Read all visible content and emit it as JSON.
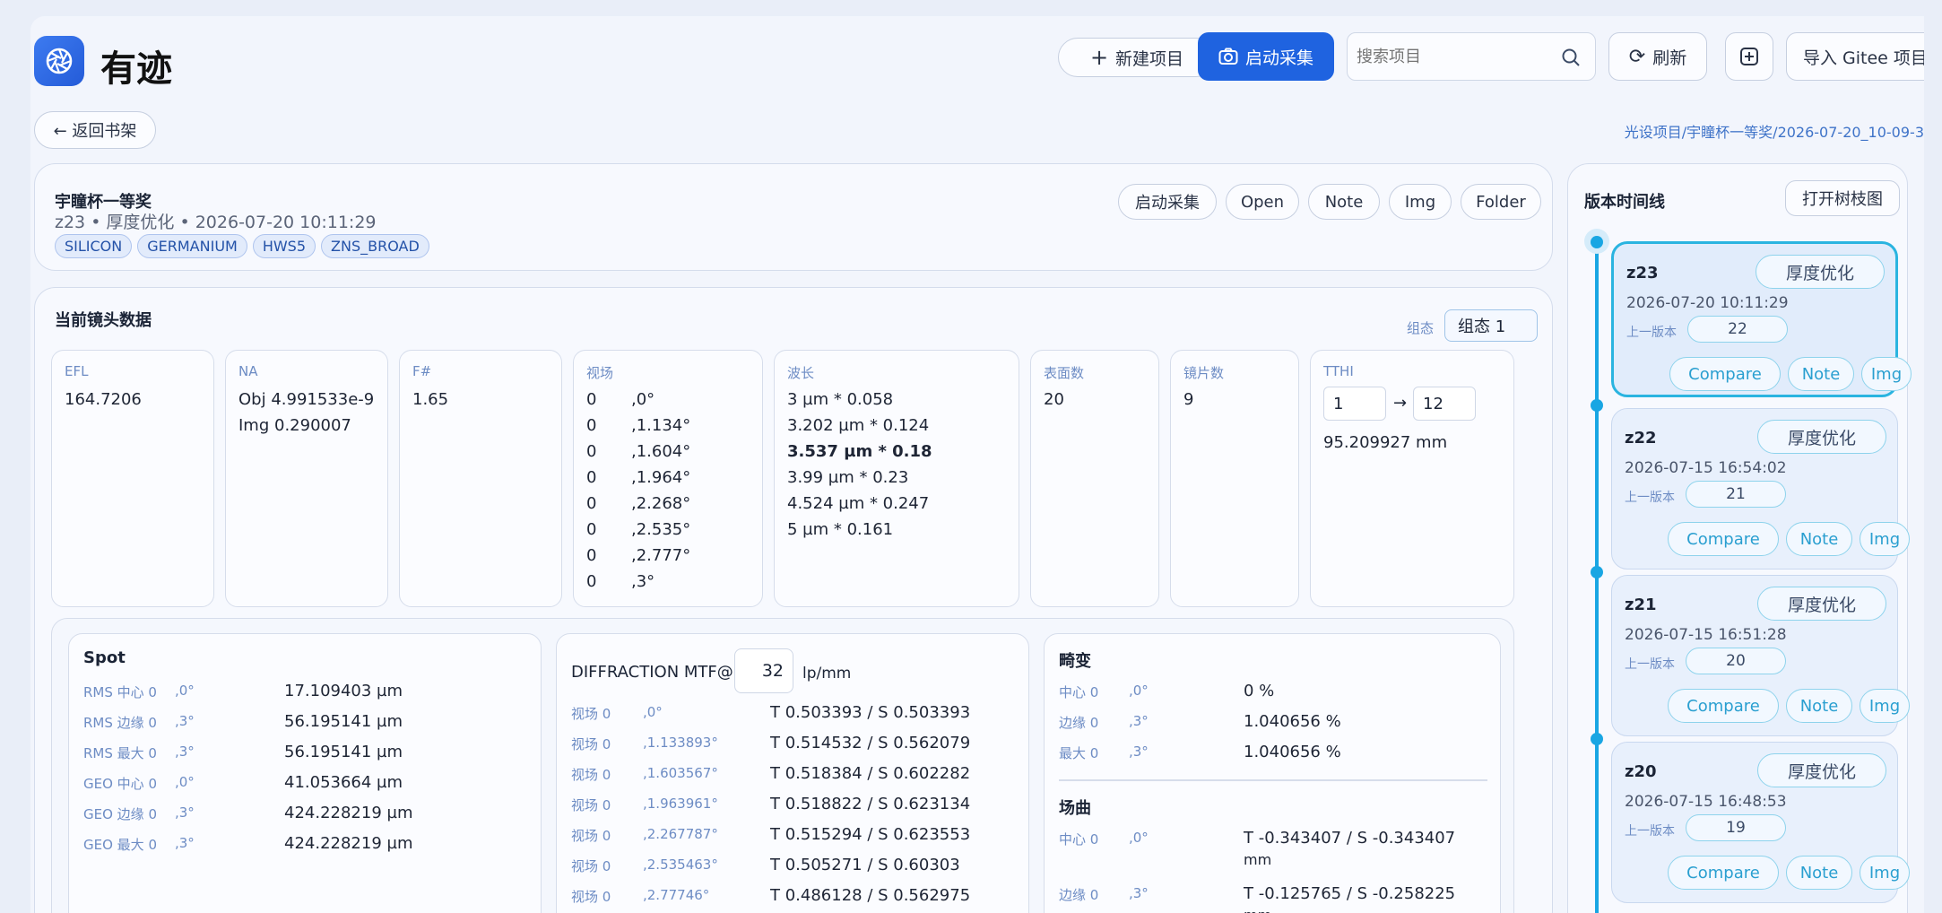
{
  "header": {
    "app_title": "有迹",
    "new_project": "新建项目",
    "start_capture": "启动采集",
    "search_placeholder": "搜索项目",
    "refresh": "刷新",
    "import_gitee": "导入 Gitee 项目"
  },
  "nav": {
    "back": "← 返回书架",
    "breadcrumb": "光设项目/宇瞳杯一等奖/2026-07-20_10-09-3"
  },
  "project": {
    "title": "宇瞳杯一等奖",
    "meta": "z23 • 厚度优化 • 2026-07-20 10:11:29",
    "tags": [
      "SILICON",
      "GERMANIUM",
      "HWS5",
      "ZNS_BROAD"
    ],
    "actions": [
      "启动采集",
      "Open",
      "Note",
      "Img",
      "Folder"
    ]
  },
  "lens": {
    "title": "当前镜头数据",
    "config_label": "组态",
    "config_value": "组态 1",
    "efl_label": "EFL",
    "efl_value": "164.7206",
    "na_label": "NA",
    "na_obj": "Obj 4.991533e-9",
    "na_img": "Img 0.290007",
    "fno_label": "F#",
    "fno_value": "1.65",
    "field_label": "视场",
    "fields": [
      {
        "x": "0",
        "y": ",0°"
      },
      {
        "x": "0",
        "y": ",1.134°"
      },
      {
        "x": "0",
        "y": ",1.604°"
      },
      {
        "x": "0",
        "y": ",1.964°"
      },
      {
        "x": "0",
        "y": ",2.268°"
      },
      {
        "x": "0",
        "y": ",2.535°"
      },
      {
        "x": "0",
        "y": ",2.777°"
      },
      {
        "x": "0",
        "y": ",3°"
      }
    ],
    "wave_label": "波长",
    "waves": [
      "3 µm * 0.058",
      "3.202 µm * 0.124",
      "3.537 µm * 0.18",
      "3.99 µm * 0.23",
      "4.524 µm * 0.247",
      "5 µm * 0.161"
    ],
    "surfaces_label": "表面数",
    "surfaces_value": "20",
    "elements_label": "镜片数",
    "elements_value": "9",
    "tthi_label": "TTHI",
    "tthi_from": "1",
    "tthi_arrow": "→",
    "tthi_to": "12",
    "tthi_value": "95.209927 mm"
  },
  "spot": {
    "title": "Spot",
    "rows": [
      {
        "label": "RMS 中心 0",
        "field": ",0°",
        "value": "17.109403 µm"
      },
      {
        "label": "RMS 边缘 0",
        "field": ",3°",
        "value": "56.195141 µm"
      },
      {
        "label": "RMS 最大 0",
        "field": ",3°",
        "value": "56.195141 µm"
      },
      {
        "label": "GEO 中心 0",
        "field": ",0°",
        "value": "41.053664 µm"
      },
      {
        "label": "GEO 边缘 0",
        "field": ",3°",
        "value": "424.228219 µm"
      },
      {
        "label": "GEO 最大 0",
        "field": ",3°",
        "value": "424.228219 µm"
      }
    ]
  },
  "mtf": {
    "title": "DIFFRACTION MTF@",
    "freq": "32",
    "unit": "lp/mm",
    "rows": [
      {
        "label": "视场 0",
        "field": ",0°",
        "value": "T 0.503393 / S 0.503393"
      },
      {
        "label": "视场 0",
        "field": ",1.133893°",
        "value": "T 0.514532 / S 0.562079"
      },
      {
        "label": "视场 0",
        "field": ",1.603567°",
        "value": "T 0.518384 / S 0.602282"
      },
      {
        "label": "视场 0",
        "field": ",1.963961°",
        "value": "T 0.518822 / S 0.623134"
      },
      {
        "label": "视场 0",
        "field": ",2.267787°",
        "value": "T 0.515294 / S 0.623553"
      },
      {
        "label": "视场 0",
        "field": ",2.535463°",
        "value": "T 0.505271 / S 0.60303"
      },
      {
        "label": "视场 0",
        "field": ",2.77746°",
        "value": "T 0.486128 / S 0.562975"
      }
    ]
  },
  "distortion": {
    "title": "畸变",
    "rows": [
      {
        "label": "中心 0",
        "field": ",0°",
        "value": "0 %"
      },
      {
        "label": "边缘 0",
        "field": ",3°",
        "value": "1.040656 %"
      },
      {
        "label": "最大 0",
        "field": ",3°",
        "value": "1.040656 %"
      }
    ]
  },
  "curvature": {
    "title": "场曲",
    "rows": [
      {
        "label": "中心 0",
        "field": ",0°",
        "value": "T -0.343407 / S -0.343407",
        "unit": "mm"
      },
      {
        "label": "边缘 0",
        "field": ",3°",
        "value": "T -0.125765 / S -0.258225",
        "unit": "mm"
      }
    ]
  },
  "timeline": {
    "title": "版本时间线",
    "open_tree": "打开树枝图",
    "prev_label": "上一版本",
    "buttons": [
      "Compare",
      "Note",
      "Img"
    ],
    "versions": [
      {
        "name": "z23",
        "tag": "厚度优化",
        "date": "2026-07-20 10:11:29",
        "prev": "22"
      },
      {
        "name": "z22",
        "tag": "厚度优化",
        "date": "2026-07-15 16:54:02",
        "prev": "21"
      },
      {
        "name": "z21",
        "tag": "厚度优化",
        "date": "2026-07-15 16:51:28",
        "prev": "20"
      },
      {
        "name": "z20",
        "tag": "厚度优化",
        "date": "2026-07-15 16:48:53",
        "prev": "19"
      }
    ]
  },
  "colors": {
    "accent": "#1f63e0",
    "timeline": "#19a6e3",
    "tag_bg": "#e2ebfb"
  }
}
